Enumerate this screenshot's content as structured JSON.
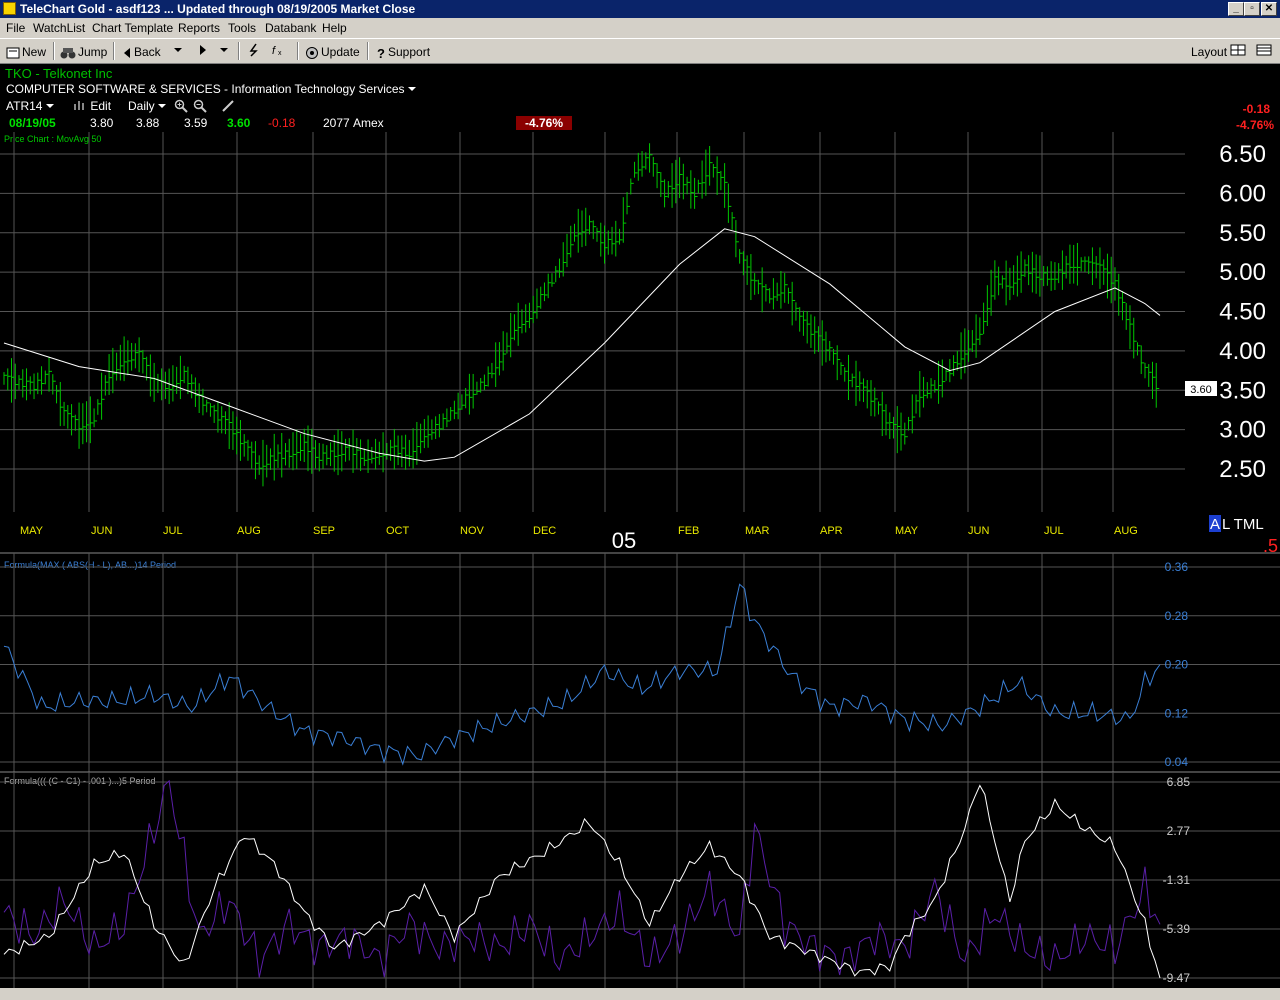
{
  "window": {
    "title": "TeleChart Gold - asdf123  ... Updated through 08/19/2005  Market Close",
    "buttons": [
      "_",
      "▫",
      "✕"
    ]
  },
  "menu": [
    "File",
    "WatchList",
    "Chart Template",
    "Reports",
    "Tools",
    "Databank",
    "Help"
  ],
  "toolbar": {
    "new": "New",
    "jump": "Jump",
    "back": "Back",
    "update": "Update",
    "support": "Support",
    "layout": "Layout"
  },
  "stock": {
    "symbol_name": "TKO  -  Telkonet Inc",
    "sector": "COMPUTER SOFTWARE & SERVICES - Information Technology Services",
    "indicator_select": "ATR14",
    "edit": "Edit",
    "period": "Daily",
    "date": "08/19/05",
    "open": "3.80",
    "high": "3.88",
    "low": "3.59",
    "close": "3.60",
    "change": "-0.18",
    "volume": "2077",
    "exchange": "Amex",
    "pct_change_badge": "-4.76%",
    "right_change": "-0.18",
    "right_pct": "-4.76%",
    "price_chart_label": "Price Chart : MovAvg 50",
    "price_tag": "3.60",
    "year_label": "05",
    "right_codes": "AL TML",
    "right_code_highlight": "A",
    "right_code_rest": "L TML",
    "right_small": ".5"
  },
  "colors": {
    "up": "#00c800",
    "down": "#ff2020",
    "ma": "#ffffff",
    "atr": "#3a7fd5",
    "osc": "#5a1fa8",
    "badge": "#8b0000",
    "grid": "#555555",
    "month": "#e8e800"
  },
  "chart_data": [
    {
      "type": "bar",
      "title": "Price Chart : MovAvg 50",
      "xlabel": "",
      "ylabel": "",
      "x_tick_labels": [
        "MAY",
        "JUN",
        "JUL",
        "AUG",
        "SEP",
        "OCT",
        "NOV",
        "DEC",
        "FEB",
        "MAR",
        "APR",
        "MAY",
        "JUN",
        "JUL",
        "AUG"
      ],
      "y_tick_labels": [
        "6.50",
        "6.00",
        "5.50",
        "5.00",
        "4.50",
        "4.00",
        "3.50",
        "3.00",
        "2.50"
      ],
      "ylim": [
        2.5,
        6.5
      ],
      "series": [
        {
          "name": "",
          "type": "ohlc",
          "points": [
            [
              0,
              3.65
            ],
            [
              2,
              3.6
            ],
            [
              4,
              3.55
            ],
            [
              6,
              3.7
            ],
            [
              8,
              3.2
            ],
            [
              10,
              3.05
            ],
            [
              12,
              3.15
            ],
            [
              14,
              3.7
            ],
            [
              16,
              3.9
            ],
            [
              18,
              3.95
            ],
            [
              20,
              3.6
            ],
            [
              22,
              3.55
            ],
            [
              24,
              3.7
            ],
            [
              26,
              3.4
            ],
            [
              28,
              3.2
            ],
            [
              30,
              3.05
            ],
            [
              32,
              2.8
            ],
            [
              34,
              2.55
            ],
            [
              36,
              2.65
            ],
            [
              38,
              2.7
            ],
            [
              40,
              2.8
            ],
            [
              42,
              2.65
            ],
            [
              44,
              2.7
            ],
            [
              46,
              2.75
            ],
            [
              48,
              2.65
            ],
            [
              50,
              2.7
            ],
            [
              52,
              2.75
            ],
            [
              54,
              2.7
            ],
            [
              56,
              2.95
            ],
            [
              58,
              3.05
            ],
            [
              60,
              3.25
            ],
            [
              62,
              3.45
            ],
            [
              64,
              3.6
            ],
            [
              66,
              3.9
            ],
            [
              68,
              4.3
            ],
            [
              70,
              4.45
            ],
            [
              72,
              4.75
            ],
            [
              74,
              5.05
            ],
            [
              76,
              5.5
            ],
            [
              78,
              5.6
            ],
            [
              80,
              5.35
            ],
            [
              82,
              5.45
            ],
            [
              84,
              6.3
            ],
            [
              86,
              6.45
            ],
            [
              88,
              6.0
            ],
            [
              90,
              6.2
            ],
            [
              92,
              6.0
            ],
            [
              94,
              6.35
            ],
            [
              96,
              6.1
            ],
            [
              98,
              5.2
            ],
            [
              100,
              4.85
            ],
            [
              102,
              4.7
            ],
            [
              104,
              4.8
            ],
            [
              106,
              4.4
            ],
            [
              108,
              4.2
            ],
            [
              110,
              4.0
            ],
            [
              112,
              3.7
            ],
            [
              114,
              3.55
            ],
            [
              116,
              3.35
            ],
            [
              118,
              3.05
            ],
            [
              120,
              2.95
            ],
            [
              122,
              3.45
            ],
            [
              124,
              3.55
            ],
            [
              126,
              3.75
            ],
            [
              128,
              4.0
            ],
            [
              130,
              4.25
            ],
            [
              132,
              4.9
            ],
            [
              134,
              4.85
            ],
            [
              136,
              5.05
            ],
            [
              138,
              4.95
            ],
            [
              140,
              4.95
            ],
            [
              142,
              5.1
            ],
            [
              144,
              5.1
            ],
            [
              146,
              5.05
            ],
            [
              148,
              4.85
            ],
            [
              150,
              4.3
            ],
            [
              152,
              3.75
            ],
            [
              154,
              3.5
            ]
          ]
        },
        {
          "name": "",
          "type": "line",
          "points": [
            [
              0,
              4.1
            ],
            [
              10,
              3.8
            ],
            [
              20,
              3.65
            ],
            [
              30,
              3.3
            ],
            [
              40,
              2.95
            ],
            [
              50,
              2.7
            ],
            [
              56,
              2.6
            ],
            [
              60,
              2.65
            ],
            [
              70,
              3.2
            ],
            [
              80,
              4.1
            ],
            [
              90,
              5.1
            ],
            [
              96,
              5.55
            ],
            [
              100,
              5.45
            ],
            [
              110,
              4.85
            ],
            [
              120,
              4.05
            ],
            [
              126,
              3.75
            ],
            [
              130,
              3.85
            ],
            [
              140,
              4.5
            ],
            [
              148,
              4.8
            ],
            [
              152,
              4.6
            ],
            [
              154,
              4.45
            ]
          ]
        }
      ]
    },
    {
      "type": "line",
      "title": "Formula(MAX ( ABS(H - L), AB...)14 Period",
      "xlabel": "",
      "ylabel": "",
      "y_tick_labels": [
        "0.36",
        "0.28",
        "0.20",
        "0.12",
        "0.04"
      ],
      "ylim": [
        0.04,
        0.36
      ],
      "series": [
        {
          "name": "",
          "points": [
            [
              0,
              0.23
            ],
            [
              5,
              0.13
            ],
            [
              10,
              0.14
            ],
            [
              15,
              0.14
            ],
            [
              20,
              0.15
            ],
            [
              25,
              0.13
            ],
            [
              30,
              0.18
            ],
            [
              35,
              0.13
            ],
            [
              40,
              0.09
            ],
            [
              45,
              0.08
            ],
            [
              50,
              0.06
            ],
            [
              55,
              0.05
            ],
            [
              60,
              0.08
            ],
            [
              65,
              0.1
            ],
            [
              70,
              0.12
            ],
            [
              75,
              0.14
            ],
            [
              80,
              0.19
            ],
            [
              85,
              0.16
            ],
            [
              90,
              0.19
            ],
            [
              95,
              0.19
            ],
            [
              98,
              0.33
            ],
            [
              100,
              0.27
            ],
            [
              105,
              0.18
            ],
            [
              110,
              0.13
            ],
            [
              115,
              0.14
            ],
            [
              120,
              0.11
            ],
            [
              125,
              0.1
            ],
            [
              130,
              0.13
            ],
            [
              135,
              0.17
            ],
            [
              140,
              0.12
            ],
            [
              145,
              0.12
            ],
            [
              150,
              0.11
            ],
            [
              152,
              0.17
            ],
            [
              154,
              0.2
            ]
          ]
        }
      ]
    },
    {
      "type": "line",
      "title": "Formula((( (C - C1) - .001 )...)5 Period",
      "xlabel": "",
      "ylabel": "",
      "y_tick_labels": [
        "6.85",
        "2.77",
        "-1.31",
        "-5.39",
        "-9.47"
      ],
      "ylim": [
        -9.47,
        6.85
      ],
      "series": [
        {
          "name": "",
          "points": [
            [
              0,
              -7.5
            ],
            [
              6,
              -6
            ],
            [
              12,
              0
            ],
            [
              16,
              1
            ],
            [
              20,
              -5
            ],
            [
              24,
              -8.5
            ],
            [
              28,
              -2
            ],
            [
              32,
              2.5
            ],
            [
              36,
              0
            ],
            [
              40,
              -4
            ],
            [
              44,
              -7
            ],
            [
              50,
              -5
            ],
            [
              56,
              -2
            ],
            [
              60,
              -6
            ],
            [
              66,
              -1
            ],
            [
              72,
              1
            ],
            [
              78,
              3.5
            ],
            [
              82,
              0
            ],
            [
              86,
              -5
            ],
            [
              90,
              -1
            ],
            [
              94,
              1.5
            ],
            [
              98,
              -1
            ],
            [
              102,
              -6
            ],
            [
              106,
              -7
            ],
            [
              110,
              -8
            ],
            [
              114,
              -9
            ],
            [
              118,
              -8.5
            ],
            [
              120,
              -6
            ],
            [
              124,
              -3
            ],
            [
              128,
              3
            ],
            [
              130,
              7
            ],
            [
              134,
              -3
            ],
            [
              136,
              2
            ],
            [
              140,
              5
            ],
            [
              144,
              3
            ],
            [
              148,
              1.5
            ],
            [
              152,
              -5
            ],
            [
              154,
              -9.47
            ]
          ]
        },
        {
          "name": "",
          "points": [
            [
              0,
              -4
            ],
            [
              4,
              -6
            ],
            [
              8,
              -3
            ],
            [
              12,
              -7
            ],
            [
              16,
              -5
            ],
            [
              18,
              -1
            ],
            [
              22,
              6.85
            ],
            [
              26,
              -6
            ],
            [
              30,
              -3
            ],
            [
              34,
              -8
            ],
            [
              38,
              -5
            ],
            [
              42,
              -7
            ],
            [
              46,
              -6
            ],
            [
              50,
              -8
            ],
            [
              54,
              -5
            ],
            [
              58,
              -7
            ],
            [
              62,
              -6
            ],
            [
              66,
              -7
            ],
            [
              70,
              -5
            ],
            [
              74,
              -8
            ],
            [
              78,
              -6
            ],
            [
              82,
              -4
            ],
            [
              86,
              -8
            ],
            [
              90,
              -6
            ],
            [
              94,
              -2
            ],
            [
              98,
              -6
            ],
            [
              100,
              3
            ],
            [
              104,
              -5
            ],
            [
              108,
              -7
            ],
            [
              112,
              -8
            ],
            [
              116,
              -6
            ],
            [
              120,
              -7
            ],
            [
              124,
              -2
            ],
            [
              128,
              -8
            ],
            [
              132,
              -4
            ],
            [
              136,
              -7
            ],
            [
              140,
              -8
            ],
            [
              144,
              -6
            ],
            [
              148,
              -7
            ],
            [
              152,
              -2
            ],
            [
              154,
              -5
            ]
          ]
        }
      ]
    }
  ]
}
